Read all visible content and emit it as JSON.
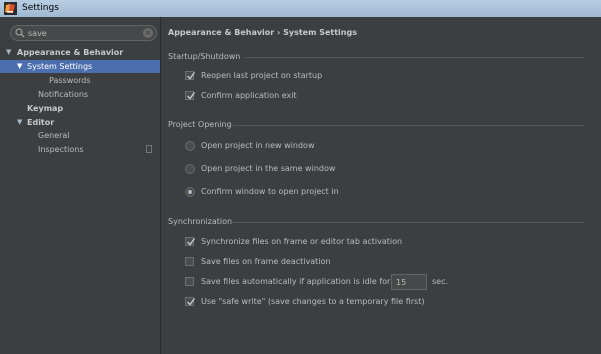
{
  "window": {
    "title": "Settings"
  },
  "search": {
    "value": "save"
  },
  "tree": [
    {
      "label": "Appearance & Behavior",
      "bold": true,
      "arrow": "▼"
    },
    {
      "label": "System Settings",
      "selected": true,
      "arrow": "▼"
    },
    {
      "label": "Passwords"
    },
    {
      "label": "Notifications"
    },
    {
      "label": "Keymap",
      "bold": true
    },
    {
      "label": "Editor",
      "bold": true,
      "arrow": "▼"
    },
    {
      "label": "General"
    },
    {
      "label": "Inspections"
    }
  ],
  "breadcrumb": "Appearance & Behavior › System Settings",
  "startup": {
    "title": "Startup/Shutdown",
    "reopen": {
      "label": "Reopen last project on startup",
      "checked": true
    },
    "confirm_exit": {
      "label": "Confirm application exit",
      "checked": true
    }
  },
  "project_opening": {
    "title": "Project Opening",
    "options": [
      {
        "label": "Open project in new window",
        "selected": false
      },
      {
        "label": "Open project in the same window",
        "selected": false
      },
      {
        "label": "Confirm window to open project in",
        "selected": true
      }
    ]
  },
  "sync": {
    "title": "Synchronization",
    "sync_on_frame": {
      "label": "Synchronize files on frame or editor tab activation",
      "checked": true
    },
    "save_on_deactivation": {
      "label": "Save files on frame deactivation",
      "checked": false
    },
    "save_auto": {
      "label": "Save files automatically if application is idle for",
      "checked": false,
      "seconds": "15",
      "unit": "sec."
    },
    "safe_write": {
      "label": "Use \"safe write\" (save changes to a temporary file first)",
      "checked": true
    }
  }
}
